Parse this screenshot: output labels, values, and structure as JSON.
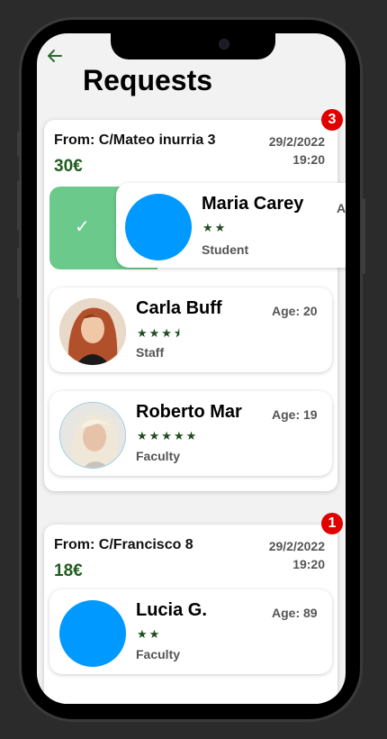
{
  "app": {
    "title": "Requests"
  },
  "requests": [
    {
      "from": "From: C/Mateo inurria 3",
      "price": "30€",
      "date": "29/2/2022",
      "time": "19:20",
      "badge": "3",
      "people": [
        {
          "name": "Maria Carey",
          "stars": "★★",
          "role": "Student",
          "age": "A",
          "avatar": "blue-circle"
        },
        {
          "name": "Carla Buff",
          "stars": "★★★⯨",
          "role": "Staff",
          "age": "Age: 20",
          "avatar": "red-hair-photo"
        },
        {
          "name": "Roberto Mar",
          "stars": "★★★★★",
          "role": "Faculty",
          "age": "Age: 19",
          "avatar": "blond-photo"
        }
      ]
    },
    {
      "from": "From: C/Francisco 8",
      "price": "18€",
      "date": "29/2/2022",
      "time": "19:20",
      "badge": "1",
      "people": [
        {
          "name": "Lucia G.",
          "stars": "★★",
          "role": "Faculty",
          "age": "Age: 89",
          "avatar": "blue-circle"
        }
      ]
    }
  ],
  "icons": {
    "back": "arrow-left-icon",
    "accept": "check-icon"
  },
  "colors": {
    "accent_green": "#1f5c1f",
    "accept_green": "#6cc98c",
    "badge_red": "#e00000",
    "avatar_blue": "#0099ff"
  }
}
